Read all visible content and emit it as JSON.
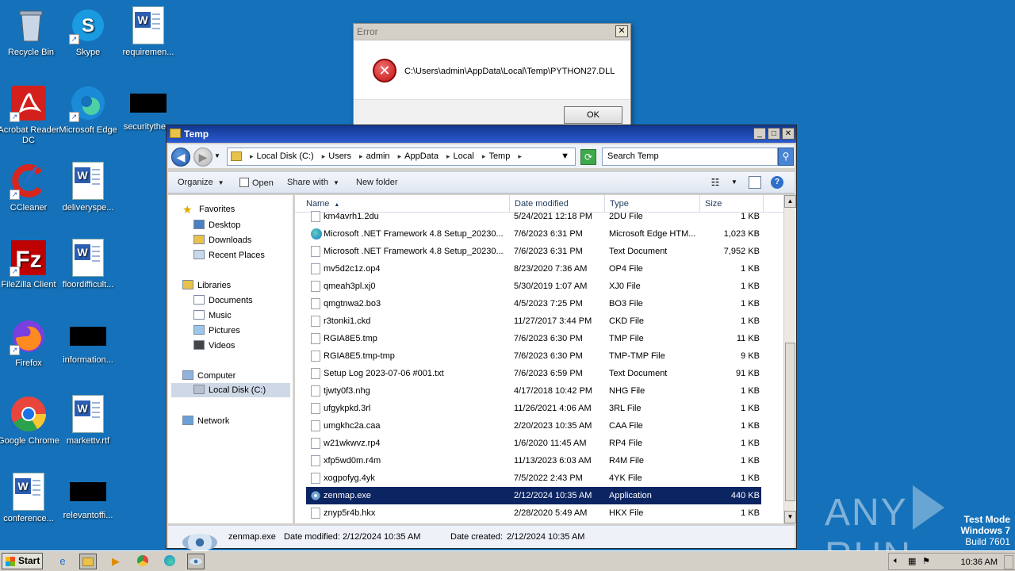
{
  "desktop": {
    "icons": [
      {
        "label": "Recycle Bin"
      },
      {
        "label": "Skype"
      },
      {
        "label": "requiremen..."
      },
      {
        "label": "Acrobat Reader DC"
      },
      {
        "label": "Microsoft Edge"
      },
      {
        "label": "securitythe..."
      },
      {
        "label": "CCleaner"
      },
      {
        "label": "deliveryspe..."
      },
      {
        "label": "FileZilla Client"
      },
      {
        "label": "floordifficult..."
      },
      {
        "label": "Firefox"
      },
      {
        "label": "information..."
      },
      {
        "label": "Google Chrome"
      },
      {
        "label": "markettv.rtf"
      },
      {
        "label": "conference..."
      },
      {
        "label": "relevantoffi..."
      }
    ]
  },
  "error_dialog": {
    "title": "Error",
    "close_glyph": "✕",
    "message": "C:\\Users\\admin\\AppData\\Local\\Temp\\PYTHON27.DLL",
    "ok_label": "OK",
    "icon_glyph": "✕"
  },
  "explorer": {
    "title": "Temp",
    "controls": {
      "minimize": "_",
      "maximize": "□",
      "close": "✕"
    },
    "address": {
      "parts": [
        "Local Disk (C:)",
        "Users",
        "admin",
        "AppData",
        "Local",
        "Temp"
      ],
      "separator": "▸"
    },
    "search_placeholder": "Search Temp",
    "commands": {
      "organize": "Organize",
      "open": "Open",
      "share_with": "Share with",
      "new_folder": "New folder"
    },
    "nav": {
      "favorites": "Favorites",
      "desktop": "Desktop",
      "downloads": "Downloads",
      "recent_places": "Recent Places",
      "libraries": "Libraries",
      "documents": "Documents",
      "music": "Music",
      "pictures": "Pictures",
      "videos": "Videos",
      "computer": "Computer",
      "local_disk": "Local Disk (C:)",
      "network": "Network"
    },
    "columns": {
      "name": "Name",
      "date": "Date modified",
      "type": "Type",
      "size": "Size"
    },
    "files": [
      {
        "name": "km4avrh1.2du",
        "date": "5/24/2021 12:18 PM",
        "type": "2DU File",
        "size": "1 KB",
        "icon": "file-icon"
      },
      {
        "name": "Microsoft .NET Framework 4.8 Setup_20230...",
        "date": "7/6/2023 6:31 PM",
        "type": "Microsoft Edge HTM...",
        "size": "1,023 KB",
        "icon": "edge-html-icon"
      },
      {
        "name": "Microsoft .NET Framework 4.8 Setup_20230...",
        "date": "7/6/2023 6:31 PM",
        "type": "Text Document",
        "size": "7,952 KB",
        "icon": "text-file-icon"
      },
      {
        "name": "mv5d2c1z.op4",
        "date": "8/23/2020 7:36 AM",
        "type": "OP4 File",
        "size": "1 KB",
        "icon": "file-icon"
      },
      {
        "name": "qmeah3pl.xj0",
        "date": "5/30/2019 1:07 AM",
        "type": "XJ0 File",
        "size": "1 KB",
        "icon": "file-icon"
      },
      {
        "name": "qmgtnwa2.bo3",
        "date": "4/5/2023 7:25 PM",
        "type": "BO3 File",
        "size": "1 KB",
        "icon": "file-icon"
      },
      {
        "name": "r3tonki1.ckd",
        "date": "11/27/2017 3:44 PM",
        "type": "CKD File",
        "size": "1 KB",
        "icon": "file-icon"
      },
      {
        "name": "RGIA8E5.tmp",
        "date": "7/6/2023 6:30 PM",
        "type": "TMP File",
        "size": "11 KB",
        "icon": "file-icon"
      },
      {
        "name": "RGIA8E5.tmp-tmp",
        "date": "7/6/2023 6:30 PM",
        "type": "TMP-TMP File",
        "size": "9 KB",
        "icon": "file-icon"
      },
      {
        "name": "Setup Log 2023-07-06 #001.txt",
        "date": "7/6/2023 6:59 PM",
        "type": "Text Document",
        "size": "91 KB",
        "icon": "text-file-icon"
      },
      {
        "name": "tjwty0f3.nhg",
        "date": "4/17/2018 10:42 PM",
        "type": "NHG File",
        "size": "1 KB",
        "icon": "file-icon"
      },
      {
        "name": "ufgykpkd.3rl",
        "date": "11/26/2021 4:06 AM",
        "type": "3RL File",
        "size": "1 KB",
        "icon": "file-icon"
      },
      {
        "name": "umgkhc2a.caa",
        "date": "2/20/2023 10:35 AM",
        "type": "CAA File",
        "size": "1 KB",
        "icon": "file-icon"
      },
      {
        "name": "w21wkwvz.rp4",
        "date": "1/6/2020 11:45 AM",
        "type": "RP4 File",
        "size": "1 KB",
        "icon": "file-icon"
      },
      {
        "name": "xfp5wd0m.r4m",
        "date": "11/13/2023 6:03 AM",
        "type": "R4M File",
        "size": "1 KB",
        "icon": "file-icon"
      },
      {
        "name": "xogpofyg.4yk",
        "date": "7/5/2022 2:43 PM",
        "type": "4YK File",
        "size": "1 KB",
        "icon": "file-icon"
      },
      {
        "name": "zenmap.exe",
        "date": "2/12/2024 10:35 AM",
        "type": "Application",
        "size": "440 KB",
        "icon": "zenmap-eye-icon",
        "selected": true
      },
      {
        "name": "znyp5r4b.hkx",
        "date": "2/28/2020 5:49 AM",
        "type": "HKX File",
        "size": "1 KB",
        "icon": "file-icon"
      }
    ],
    "details": {
      "name": "zenmap.exe",
      "date_modified_label": "Date modified:",
      "date_modified": "2/12/2024 10:35 AM",
      "date_created_label": "Date created:",
      "date_created": "2/12/2024 10:35 AM"
    }
  },
  "watermark": {
    "any": "ANY",
    "run": "RUN",
    "test_mode": "Test Mode",
    "windows": "Windows 7",
    "build": "Build 7601"
  },
  "taskbar": {
    "start_label": "Start",
    "clock": "10:36 AM"
  },
  "colors": {
    "desktop_bg": "#1572ba",
    "title_bar": "#11378f",
    "selected_row": "#0b2462"
  }
}
